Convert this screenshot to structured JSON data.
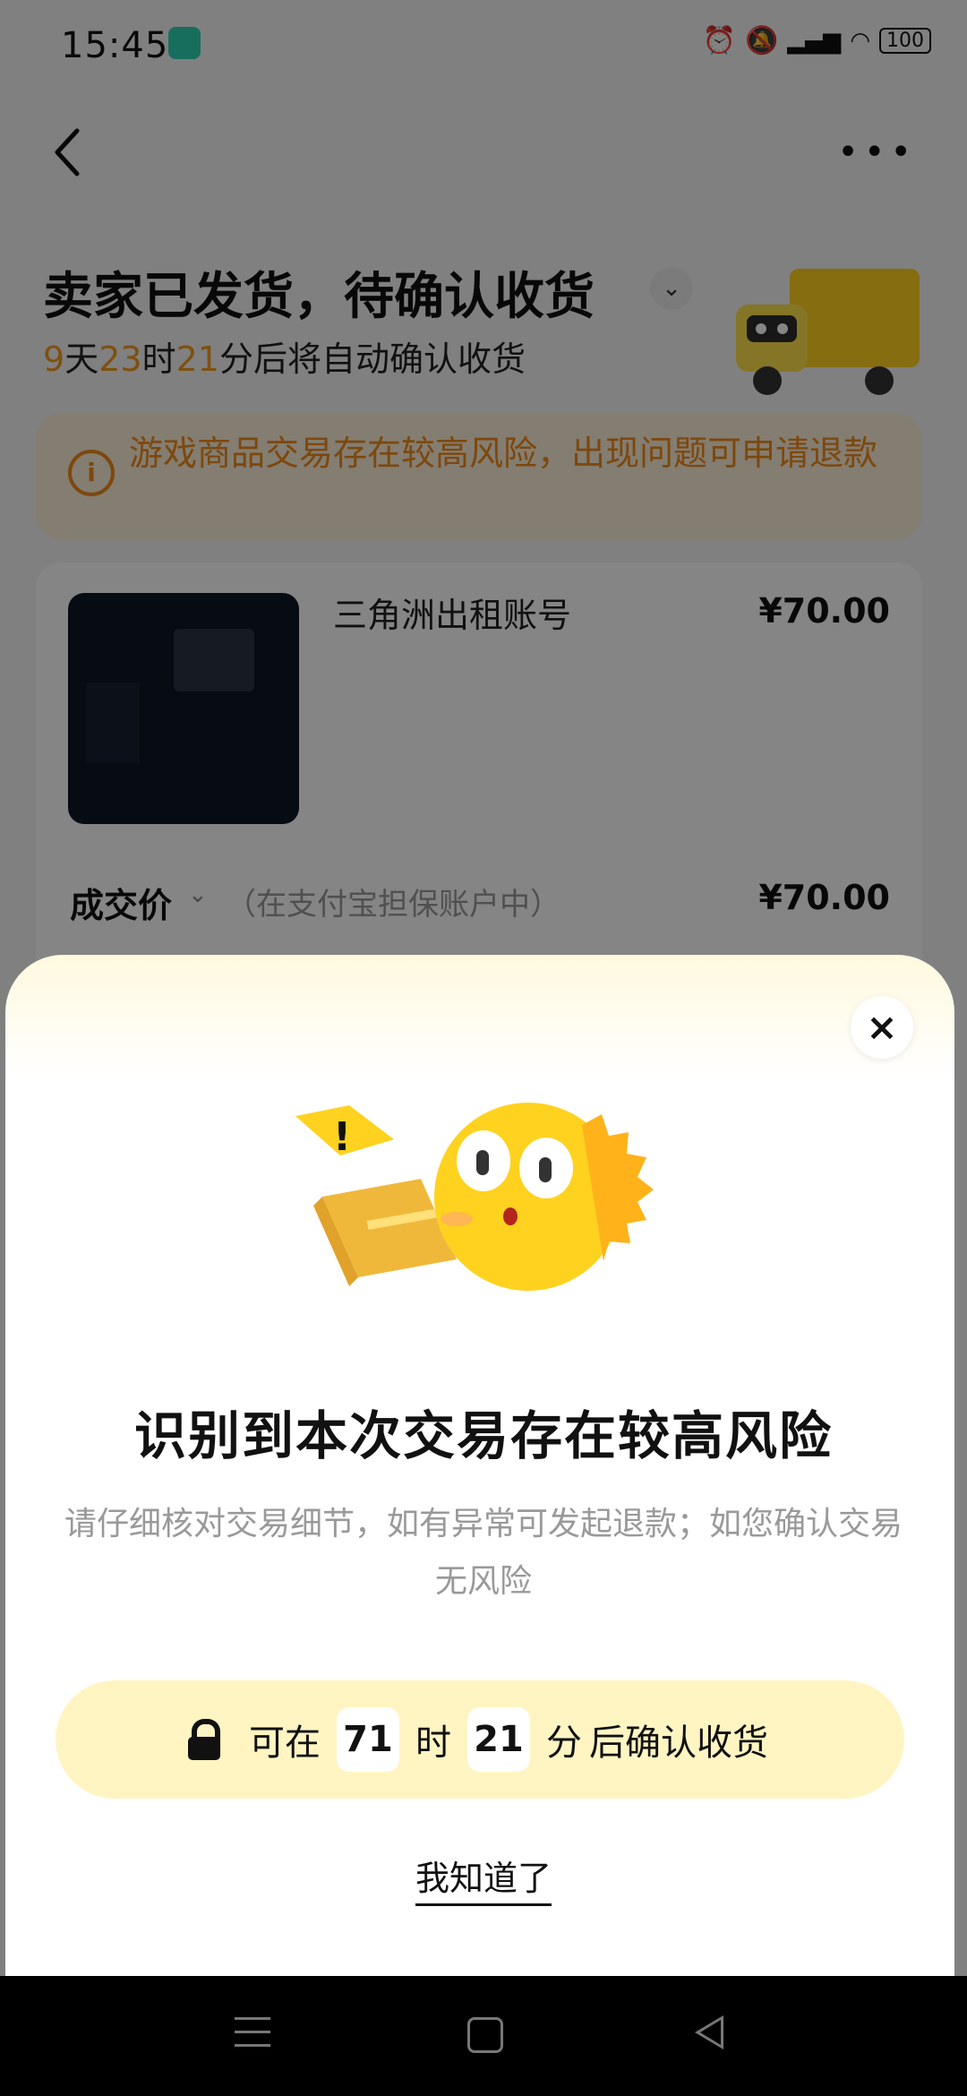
{
  "status_bar": {
    "time": "15:45",
    "battery": "100"
  },
  "order": {
    "status_title": "卖家已发货，待确认收货",
    "auto_confirm": {
      "days": "9",
      "days_unit": "天",
      "hours": "23",
      "hours_unit": "时",
      "minutes": "21",
      "minutes_unit": "分",
      "suffix": "后将自动确认收货"
    },
    "risk_banner": "游戏商品交易存在较高风险，出现问题可申请退款",
    "item": {
      "name": "三角洲出租账号",
      "price": "¥70.00"
    },
    "deal": {
      "label": "成交价",
      "note": "（在支付宝担保账户中）",
      "price": "¥70.00"
    }
  },
  "sheet": {
    "title": "识别到本次交易存在较高风险",
    "description": "请仔细核对交易细节，如有异常可发起退款；如您确认交易无风险",
    "confirm": {
      "prefix": "可在",
      "hours": "71",
      "hours_unit": "时",
      "minutes": "21",
      "minutes_unit": "分",
      "suffix": "后确认收货"
    },
    "ack_label": "我知道了",
    "close_label": "×"
  },
  "colors": {
    "accent_orange": "#f29a1f",
    "button_yellow": "#fff5c2",
    "banner_bg": "#fdf0d8"
  }
}
